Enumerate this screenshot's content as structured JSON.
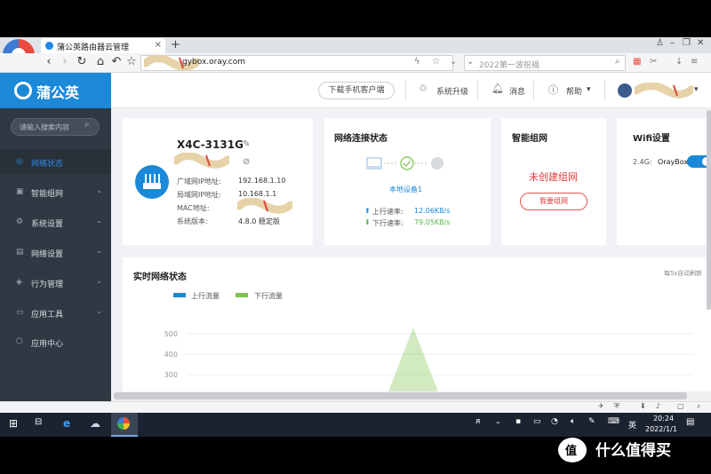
{
  "browser": {
    "tab_title": "蒲公英路由器云管理",
    "tab_close": "×",
    "new_tab": "+",
    "url_visible": "gybox.oray.com",
    "search_text": "2022第一波祝福",
    "window_controls": [
      "⌂",
      "–",
      "❐",
      "✕"
    ]
  },
  "header": {
    "brand": "蒲公英",
    "download_client": "下载手机客户端",
    "system_upgrade": "系统升级",
    "messages": "消息",
    "help": "帮助"
  },
  "sidebar": {
    "search_placeholder": "请输入搜索内容",
    "items": [
      {
        "label": "网络状态",
        "icon": "globe-icon"
      },
      {
        "label": "智能组网",
        "icon": "network-icon"
      },
      {
        "label": "系统设置",
        "icon": "gear-icon"
      },
      {
        "label": "网络设置",
        "icon": "network-settings-icon"
      },
      {
        "label": "行为管理",
        "icon": "behavior-icon"
      },
      {
        "label": "应用工具",
        "icon": "tools-icon"
      },
      {
        "label": "应用中心",
        "icon": "app-center-icon"
      }
    ]
  },
  "device": {
    "name": "X4C-3131G",
    "wan_ip_label": "广域网IP地址:",
    "wan_ip": "192.168.1.10",
    "lan_ip_label": "局域网IP地址:",
    "lan_ip": "10.168.1.1",
    "mac_label": "MAC地址:",
    "version_label": "系统版本:",
    "version": "4.8.0 稳定版"
  },
  "network": {
    "title": "网络连接状态",
    "local_device": "本地设备1",
    "up_label": "上行速率:",
    "up_value": "12.06KB/s",
    "down_label": "下行速率:",
    "down_value": "79.05KB/s"
  },
  "mesh": {
    "title": "智能组网",
    "status": "未创建组网",
    "button": "我要组网"
  },
  "wifi": {
    "title": "Wifi设置",
    "band": "2.4G:",
    "ssid": "OrayBox",
    "enabled": true
  },
  "realtime": {
    "title": "实时网络状态",
    "refresh_note": "每5s自动刷新",
    "legend_up": "上行流量",
    "legend_down": "下行流量"
  },
  "chart_data": {
    "type": "area",
    "series": [
      {
        "name": "上行流量",
        "color": "#1b88d8",
        "values": []
      },
      {
        "name": "下行流量",
        "color": "#7cc34b",
        "values": [
          0,
          0,
          0,
          0,
          530,
          0,
          0
        ]
      }
    ],
    "y_ticks": [
      "500",
      "400",
      "300",
      "200"
    ],
    "ylim": [
      200,
      500
    ]
  },
  "taskbar": {
    "ime": "英",
    "time": "20:24",
    "date": "2022/1/1"
  },
  "watermark": {
    "logo": "值",
    "text": "什么值得买"
  }
}
